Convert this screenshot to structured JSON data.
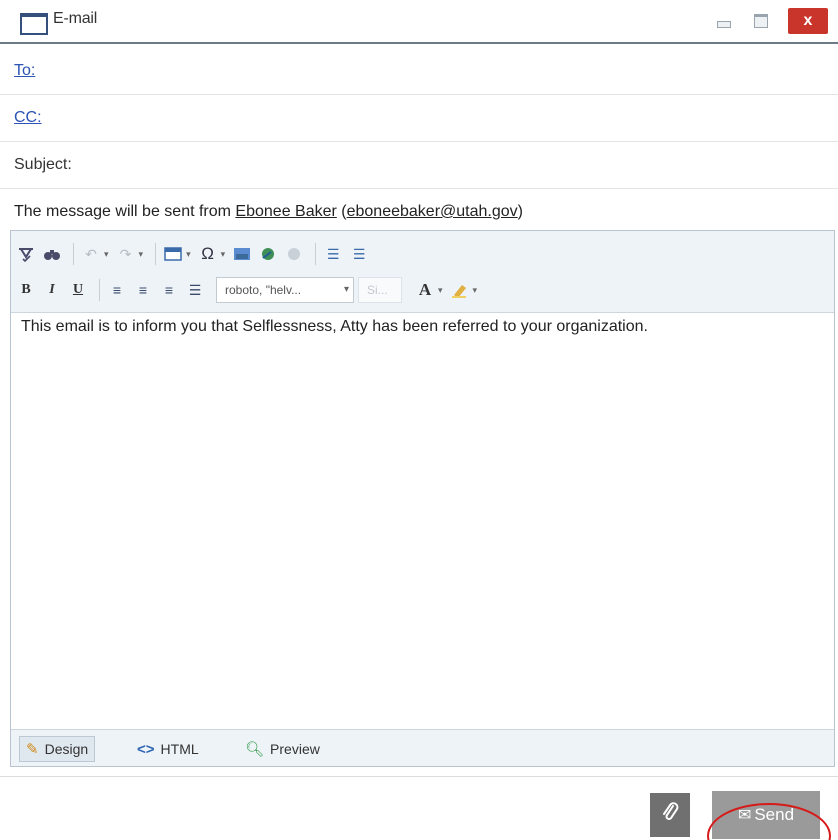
{
  "window": {
    "title": "E-mail",
    "close_label": "x"
  },
  "fields": {
    "to_label": "To:",
    "cc_label": "CC:",
    "subject_label": "Subject:",
    "from_prefix": "The message will be sent from ",
    "sender_name": "Ebonee Baker",
    "sender_email": "eboneebaker@utah.gov",
    "paren_open": " (",
    "paren_close": ")"
  },
  "toolbar": {
    "font_family_value": "roboto, \"helv...",
    "font_size_value": "Si...",
    "bold_glyph": "B",
    "italic_glyph": "I",
    "underline_glyph": "U",
    "font_color_glyph": "A",
    "special_char_glyph": "Ω"
  },
  "body": {
    "text": "This email is to inform you that Selflessness, Atty has been referred to your organization."
  },
  "modes": {
    "design": "Design",
    "html": "HTML",
    "preview": "Preview"
  },
  "footer": {
    "send_label": "Send"
  },
  "colors": {
    "close_button": "#c9352a",
    "link": "#2a53b4",
    "highlight_circle": "#d61a1a"
  }
}
